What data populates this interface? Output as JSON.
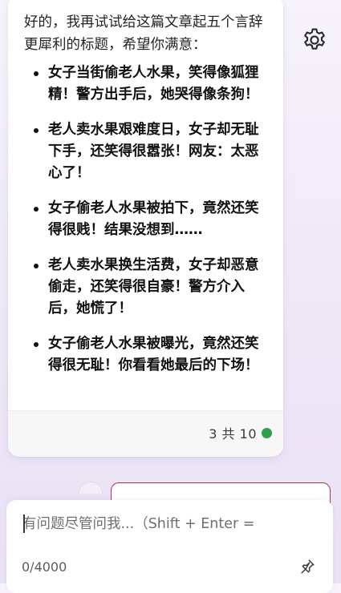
{
  "message": {
    "intro": "好的，我再试试给这篇文章起五个言辞更犀利的标题，希望你满意：",
    "titles": [
      "女子当街偷老人水果，笑得像狐狸精！警方出手后，她哭得像条狗！",
      "老人卖水果艰难度日，女子却无耻下手，还笑得很嚣张！网友：太恶心了！",
      "女子偷老人水果被拍下，竟然还笑得很贱！结果没想到……",
      "老人卖水果换生活费，女子却恶意偷走，还笑得很自豪！警方介入后，她慌了！",
      "女子偷老人水果被曝光，竟然还笑得很无耻！你看看她最后的下场！"
    ],
    "counter": "3 共 10",
    "status_color": "#2e9f4b"
  },
  "composer": {
    "placeholder": "有问题尽管问我...（Shift + Enter =",
    "value": "",
    "char_count": "0/4000"
  },
  "icons": {
    "settings": "gear-icon",
    "pin": "pin-icon"
  }
}
